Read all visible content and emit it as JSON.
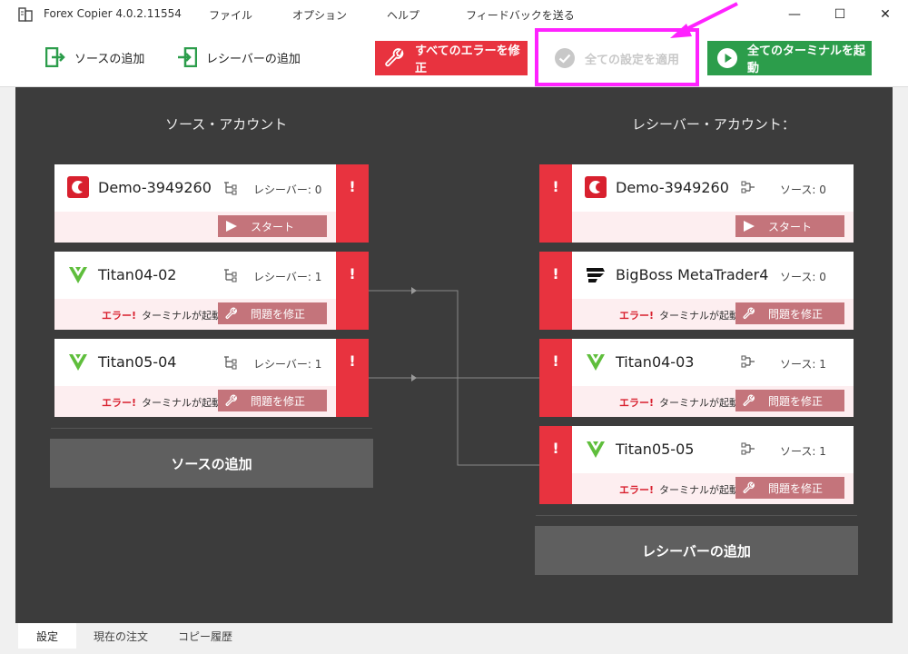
{
  "window": {
    "title": "Forex Copier 4.0.2.11554",
    "menu": [
      "ファイル",
      "オプション",
      "ヘルプ",
      "フィードバックを送る"
    ],
    "controls": {
      "minimize": "—",
      "maximize": "☐",
      "close": "✕"
    }
  },
  "toolbar": {
    "add_source": "ソースの追加",
    "add_receiver": "レシーバーの追加",
    "fix_all": "すべてのエラーを修正",
    "apply_all": "全ての設定を適用",
    "start_all": "全てのターミナルを起動"
  },
  "colors": {
    "accent_red": "#e8333f",
    "accent_green": "#2c9d4b",
    "annotation": "#ff22ff"
  },
  "sources": {
    "title": "ソース・アカウント",
    "add_label": "ソースの追加",
    "items": [
      {
        "name": "Demo-3949260",
        "count": "レシーバー: 0",
        "action": "スタート",
        "error": "",
        "error_text": "",
        "flag": "!"
      },
      {
        "name": "Titan04-02",
        "count": "レシーバー: 1",
        "action": "問題を修正",
        "error": "エラー!",
        "error_text": "ターミナルが起動",
        "flag": "!"
      },
      {
        "name": "Titan05-04",
        "count": "レシーバー: 1",
        "action": "問題を修正",
        "error": "エラー!",
        "error_text": "ターミナルが起動",
        "flag": "!"
      }
    ]
  },
  "receivers": {
    "title": "レシーバー・アカウント：",
    "add_label": "レシーバーの追加",
    "items": [
      {
        "name": "Demo-3949260",
        "count": "ソース: 0",
        "action": "スタート",
        "error": "",
        "error_text": "",
        "flag": "!"
      },
      {
        "name": "BigBoss MetaTrader4",
        "count": "ソース: 0",
        "action": "問題を修正",
        "error": "エラー!",
        "error_text": "ターミナルが起動",
        "flag": "!"
      },
      {
        "name": "Titan04-03",
        "count": "ソース: 1",
        "action": "問題を修正",
        "error": "エラー!",
        "error_text": "ターミナルが起動",
        "flag": "!"
      },
      {
        "name": "Titan05-05",
        "count": "ソース: 1",
        "action": "問題を修正",
        "error": "エラー!",
        "error_text": "ターミナルが起動",
        "flag": "!"
      }
    ]
  },
  "tabs": [
    "設定",
    "現在の注文",
    "コピー履歴"
  ]
}
